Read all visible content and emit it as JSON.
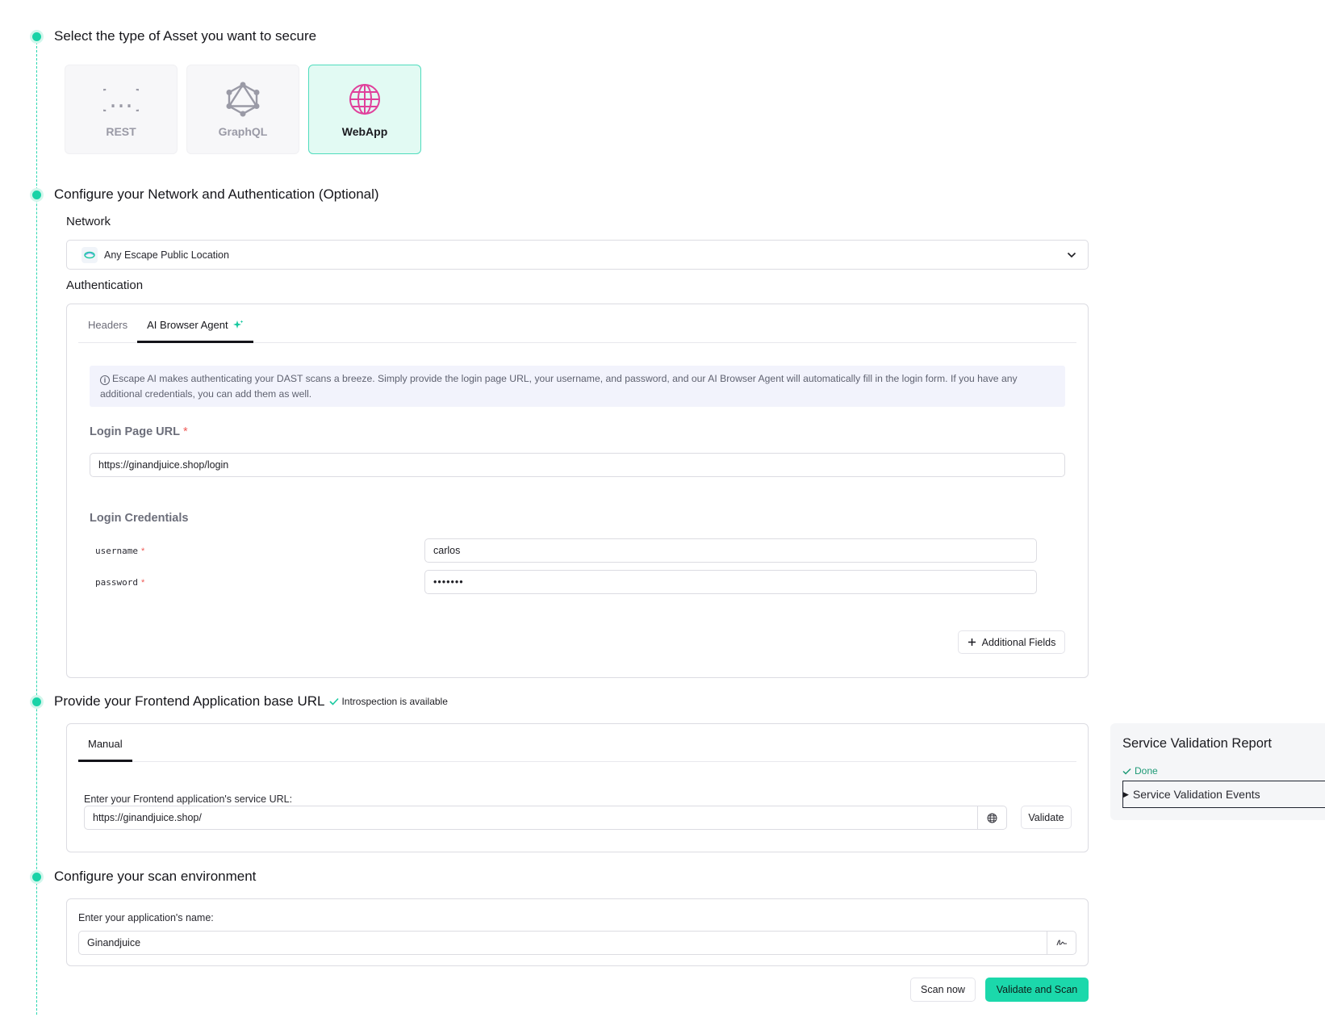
{
  "steps": {
    "asset_type": "Select the type of Asset you want to secure",
    "network_auth": "Configure your Network and Authentication (Optional)",
    "frontend_url": "Provide your Frontend Application base URL",
    "scan_env": "Configure your scan environment"
  },
  "asset_types": [
    {
      "label": "REST",
      "icon": "curly-braces-icon",
      "selected": false
    },
    {
      "label": "GraphQL",
      "icon": "graphql-icon",
      "selected": false
    },
    {
      "label": "WebApp",
      "icon": "globe-icon",
      "selected": true
    }
  ],
  "network": {
    "label": "Network",
    "selected": "Any Escape Public Location"
  },
  "authentication": {
    "label": "Authentication",
    "tabs": [
      "Headers",
      "AI Browser Agent"
    ],
    "active_tab": "AI Browser Agent",
    "info": "Escape AI makes authenticating your DAST scans a breeze. Simply provide the login page URL, your username, and password, and our AI Browser Agent will automatically fill in the login form. If you have any additional credentials, you can add them as well.",
    "login_url_label": "Login Page URL",
    "login_url_value": "https://ginandjuice.shop/login",
    "credentials_label": "Login Credentials",
    "username_label": "username",
    "username_value": "carlos",
    "password_label": "password",
    "password_value": "•••••••",
    "additional_fields": "Additional Fields",
    "required_mark": "*"
  },
  "frontend": {
    "introspection": "Introspection is available",
    "tab": "Manual",
    "prompt": "Enter your Frontend application's service URL:",
    "url_value": "https://ginandjuice.shop/",
    "validate": "Validate"
  },
  "environment": {
    "prompt": "Enter your application's name:",
    "name_value": "Ginandjuice"
  },
  "actions": {
    "scan_now": "Scan now",
    "validate_and_scan": "Validate and Scan"
  },
  "report": {
    "title": "Service Validation Report",
    "status": "Done",
    "events": "Service Validation Events"
  },
  "colors": {
    "accent": "#19d3a7",
    "selected_bg": "#e2faf3",
    "globe": "#e0409b",
    "done": "#1e9a76"
  }
}
